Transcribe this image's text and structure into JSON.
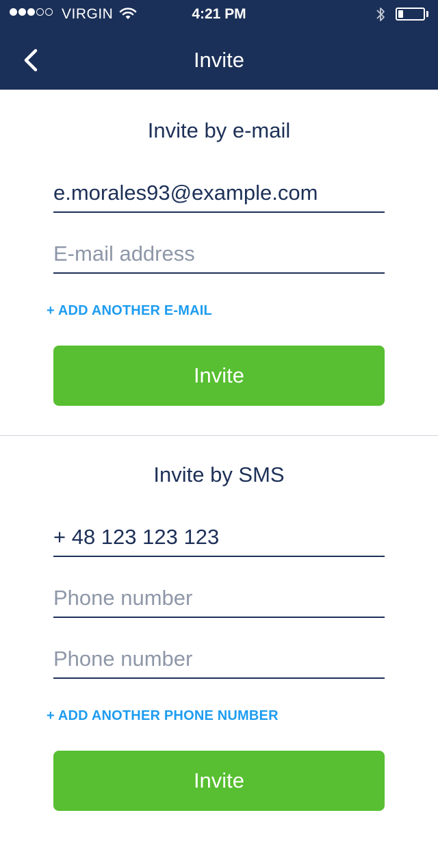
{
  "status_bar": {
    "signal_icon": "signal-dots-icon",
    "carrier": "VIRGIN",
    "wifi_icon": "wifi-icon",
    "time": "4:21 PM",
    "bluetooth_icon": "bluetooth-icon",
    "battery_icon": "battery-icon",
    "battery_level": 0.2
  },
  "nav": {
    "back_icon": "chevron-left-icon",
    "title": "Invite"
  },
  "email_section": {
    "title": "Invite by e-mail",
    "fields": [
      {
        "value": "e.morales93@example.com",
        "placeholder": "E-mail address"
      },
      {
        "value": "",
        "placeholder": "E-mail address"
      }
    ],
    "add_link": "+ ADD ANOTHER E-MAIL",
    "button": "Invite"
  },
  "sms_section": {
    "title": "Invite by SMS",
    "fields": [
      {
        "value": "+ 48 123 123 123",
        "placeholder": "Phone number"
      },
      {
        "value": "",
        "placeholder": "Phone number"
      },
      {
        "value": "",
        "placeholder": "Phone number"
      }
    ],
    "add_link": "+ ADD ANOTHER PHONE NUMBER",
    "button": "Invite"
  },
  "colors": {
    "nav_background": "#1b3058",
    "text_dark": "#1d3057",
    "link_blue": "#1e9cf0",
    "button_green": "#57bf31",
    "placeholder_gray": "#8e97a8"
  }
}
